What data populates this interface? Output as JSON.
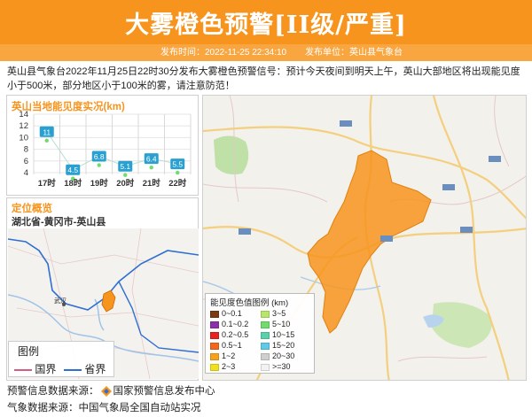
{
  "header": {
    "title": "大雾橙色预警[II级/严重]",
    "publish_time_label": "发布时间：",
    "publish_time": "2022-11-25 22:34:10",
    "publish_unit_label": "发布单位：",
    "publish_unit": "英山县气象台"
  },
  "colors": {
    "banner": "#f7941d",
    "subbar": "#f9a640",
    "fog_area": "#f7941d",
    "accent": "#f7941d"
  },
  "message": "英山县气象台2022年11月25日22时30分发布大雾橙色预警信号：预计今天夜间到明天上午，英山大部地区将出现能见度小于500米，部分地区小于100米的雾，请注意防范！",
  "visibility_panel": {
    "title": "英山当地能见度实况(km)"
  },
  "chart_data": {
    "type": "line",
    "title": "英山当地能见度实况(km)",
    "categories": [
      "17时",
      "18时",
      "19时",
      "20时",
      "21时",
      "22时"
    ],
    "values": [
      11,
      4.5,
      6.8,
      5.1,
      6.4,
      5.5
    ],
    "ylim": [
      4,
      14
    ],
    "yticks": [
      4,
      6,
      8,
      10,
      12,
      14
    ],
    "xlabel": "",
    "ylabel": "",
    "grid": "horizontal"
  },
  "location_panel": {
    "title": "定位概览",
    "region": "湖北省-黄冈市-英山县",
    "legend_title": "图例",
    "legend_items": [
      {
        "label": "国界",
        "color": "#d45d86"
      },
      {
        "label": "省界",
        "color": "#2f6fd1"
      }
    ],
    "map_labels": [
      "武汉"
    ]
  },
  "main_map": {
    "legend_title": "能见度色值图例 (km)",
    "legend_items": [
      {
        "label": "0~0.1",
        "color": "#7a3a12"
      },
      {
        "label": "0.1~0.2",
        "color": "#8b2fa8"
      },
      {
        "label": "0.2~0.5",
        "color": "#e8231f"
      },
      {
        "label": "0.5~1",
        "color": "#f4661b"
      },
      {
        "label": "1~2",
        "color": "#f7a21d"
      },
      {
        "label": "2~3",
        "color": "#f3e01c"
      },
      {
        "label": "3~5",
        "color": "#b8e66a"
      },
      {
        "label": "5~10",
        "color": "#6fdc6b"
      },
      {
        "label": "10~15",
        "color": "#59d0a8"
      },
      {
        "label": "15~20",
        "color": "#5fc9e8"
      },
      {
        "label": "20~30",
        "color": "#cfcfcf"
      },
      {
        "label": ">=30",
        "color": "#f2f2f2"
      }
    ]
  },
  "footer": {
    "warning_source_label": "预警信息数据来源：",
    "warning_source": "国家预警信息发布中心",
    "weather_source_label": "气象数据来源：",
    "weather_source": "中国气象局全国自动站实况"
  }
}
